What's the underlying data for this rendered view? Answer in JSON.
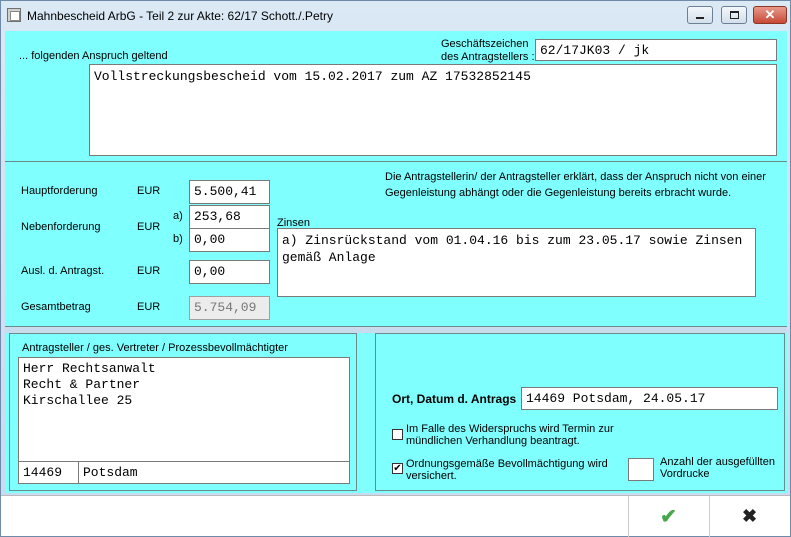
{
  "window": {
    "title": "Mahnbescheid ArbG - Teil 2   zur Akte: 62/17   Schott./.Petry",
    "controls": {
      "minimize": "minimize-icon",
      "maximize": "maximize-icon",
      "close": "✕"
    }
  },
  "claim": {
    "heading": "... folgenden Anspruch geltend",
    "ref_label_1": "Geschäftszeichen",
    "ref_label_2": "des Antragstellers :",
    "ref_value": "62/17JK03 / jk",
    "text": "Vollstreckungsbescheid vom 15.02.2017 zum AZ 17532852145"
  },
  "amounts": {
    "statement": "Die Antragstellerin/ der Antragsteller erklärt, dass der Anspruch nicht von einer Gegenleistung abhängt oder die Gegenleistung bereits erbracht wurde.",
    "currency": "EUR",
    "hauptforderung_label": "Hauptforderung",
    "hauptforderung_value": "5.500,41",
    "nebenforderung_label": "Nebenforderung",
    "neben_a_label": "a)",
    "neben_a_value": "253,68",
    "neben_b_label": "b)",
    "neben_b_value": "0,00",
    "ausl_label": "Ausl. d. Antragst.",
    "ausl_value": "0,00",
    "gesamt_label": "Gesamtbetrag",
    "gesamt_value": "5.754,09",
    "zinsen_label": "Zinsen",
    "zinsen_text": "a) Zinsrückstand vom 01.04.16 bis zum 23.05.17 sowie Zinsen gemäß Anlage"
  },
  "applicant": {
    "heading": "Antragsteller / ges. Vertreter / Prozessbevollmächtigter",
    "address": "Herr Rechtsanwalt\nRecht & Partner\nKirschallee 25",
    "zip": "14469",
    "city": "Potsdam"
  },
  "place": {
    "label": "Ort, Datum d. Antrags",
    "value": "14469 Potsdam, 24.05.17",
    "termin_label": "Im Falle des Widerspruchs wird Termin zur mündlichen Verhandlung beantragt.",
    "termin_checked": false,
    "vollmacht_label": "Ordnungsgemäße Bevollmächtigung wird versichert.",
    "vollmacht_checked": true,
    "vordrucke_label": "Anzahl der ausgefüllten Vordrucke",
    "vordrucke_value": ""
  },
  "footer": {
    "ok": "✔",
    "cancel": "✖"
  }
}
